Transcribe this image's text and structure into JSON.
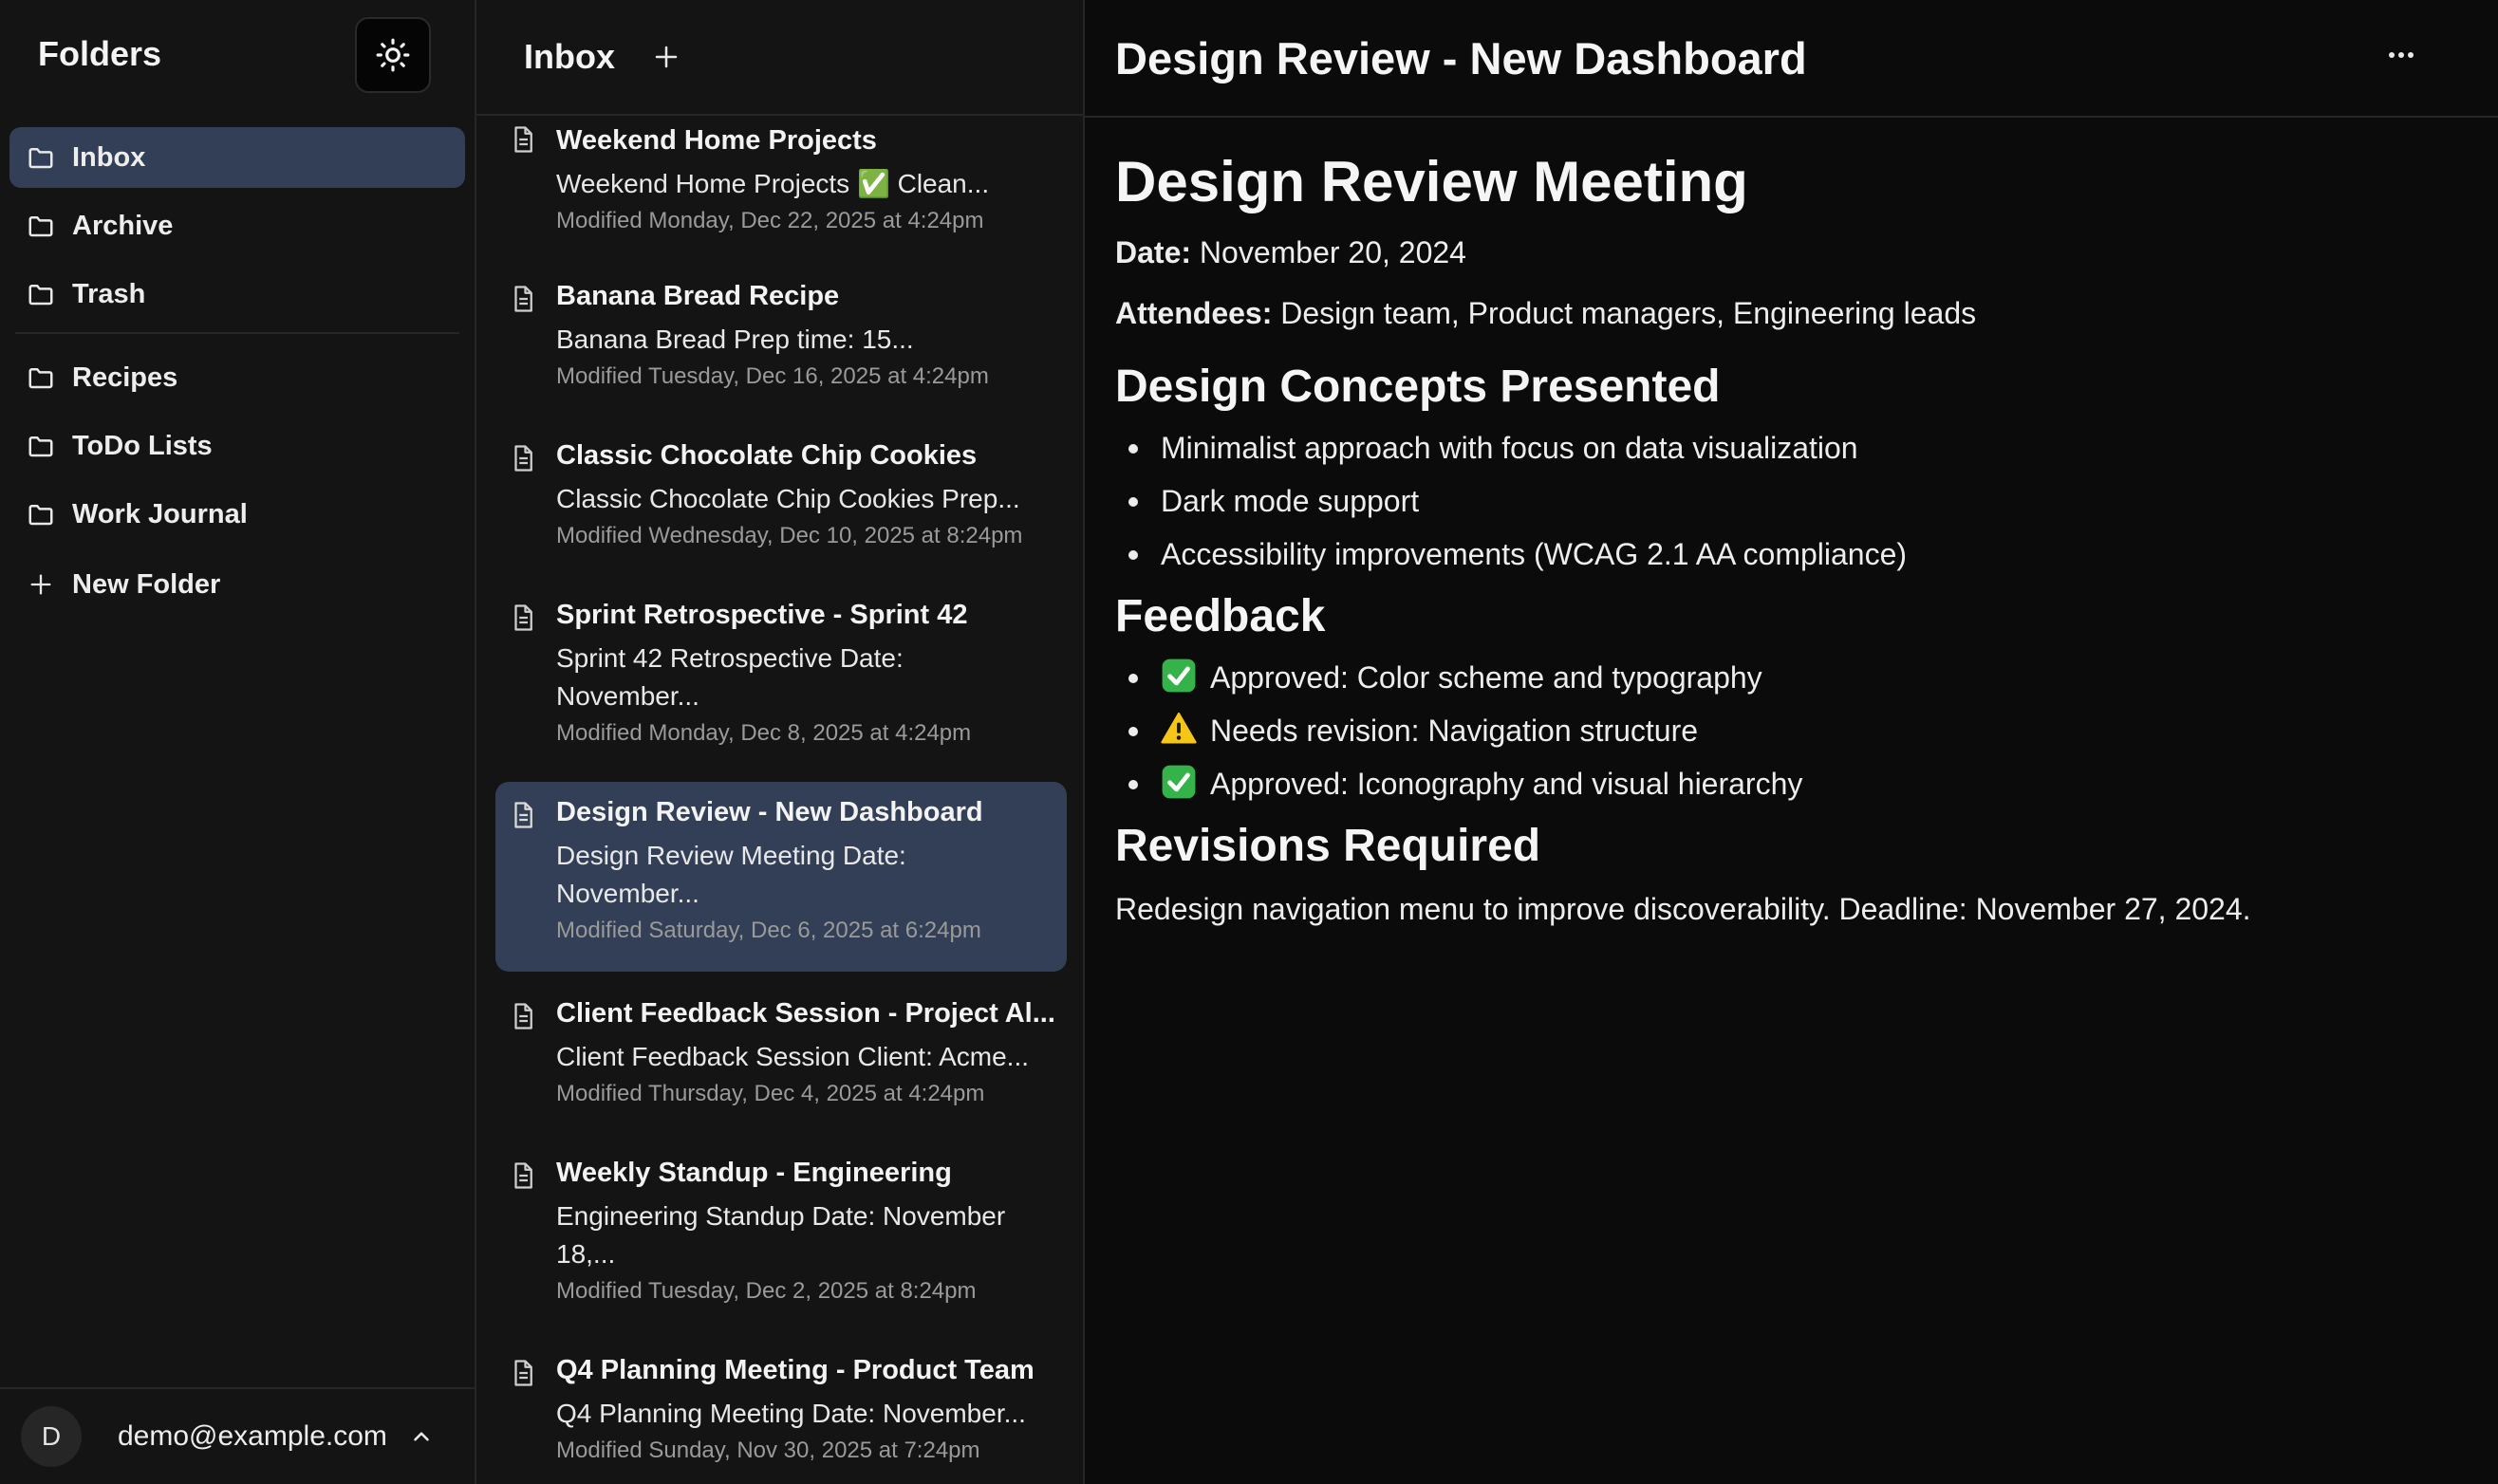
{
  "sidebar": {
    "title": "Folders",
    "items": [
      {
        "label": "Inbox",
        "active": true
      },
      {
        "label": "Archive"
      },
      {
        "label": "Trash"
      },
      {
        "label": "Recipes"
      },
      {
        "label": "ToDo Lists"
      },
      {
        "label": "Work Journal"
      }
    ],
    "new_folder_label": "New Folder",
    "user": {
      "initial": "D",
      "email": "demo@example.com"
    }
  },
  "list": {
    "title": "Inbox",
    "notes": [
      {
        "title": "Weekend Home Projects",
        "preview": "Weekend Home Projects ✅ Clean...",
        "meta": "Modified Monday, Dec 22, 2025 at 4:24pm"
      },
      {
        "title": "Banana Bread Recipe",
        "preview": "Banana Bread Prep time: 15...",
        "meta": "Modified Tuesday, Dec 16, 2025 at 4:24pm"
      },
      {
        "title": "Classic Chocolate Chip Cookies",
        "preview": "Classic Chocolate Chip Cookies Prep...",
        "meta": "Modified Wednesday, Dec 10, 2025 at 8:24pm"
      },
      {
        "title": "Sprint Retrospective - Sprint 42",
        "preview": "Sprint 42 Retrospective Date: November...",
        "meta": "Modified Monday, Dec 8, 2025 at 4:24pm"
      },
      {
        "title": "Design Review - New Dashboard",
        "preview": "Design Review Meeting Date: November...",
        "meta": "Modified Saturday, Dec 6, 2025 at 6:24pm",
        "active": true
      },
      {
        "title": "Client Feedback Session - Project Al...",
        "preview": "Client Feedback Session Client: Acme...",
        "meta": "Modified Thursday, Dec 4, 2025 at 4:24pm"
      },
      {
        "title": "Weekly Standup - Engineering",
        "preview": "Engineering Standup Date: November 18,...",
        "meta": "Modified Tuesday, Dec 2, 2025 at 8:24pm"
      },
      {
        "title": "Q4 Planning Meeting - Product Team",
        "preview": "Q4 Planning Meeting Date: November...",
        "meta": "Modified Sunday, Nov 30, 2025 at 7:24pm"
      }
    ]
  },
  "editor": {
    "title": "Design Review - New Dashboard",
    "heading": "Design Review Meeting",
    "date_label": "Date:",
    "date_value": " November 20, 2024",
    "attendees_label": "Attendees:",
    "attendees_value": " Design team, Product managers, Engineering leads",
    "concepts_heading": "Design Concepts Presented",
    "concepts": [
      "Minimalist approach with focus on data visualization",
      "Dark mode support",
      "Accessibility improvements (WCAG 2.1 AA compliance)"
    ],
    "feedback_heading": "Feedback",
    "feedback": [
      {
        "icon": "check-mark-icon",
        "text": "Approved: Color scheme and typography"
      },
      {
        "icon": "warning-icon",
        "text": "Needs revision: Navigation structure"
      },
      {
        "icon": "check-mark-icon",
        "text": "Approved: Iconography and visual hierarchy"
      }
    ],
    "revisions_heading": "Revisions Required",
    "revisions_text": "Redesign navigation menu to improve discoverability. Deadline: November 27, 2024."
  },
  "colors": {
    "active_bg": "#333f57",
    "panel_bg": "#141414",
    "editor_bg": "#0b0b0b",
    "check_green": "#35b24a",
    "warning_yellow": "#f5c518"
  }
}
